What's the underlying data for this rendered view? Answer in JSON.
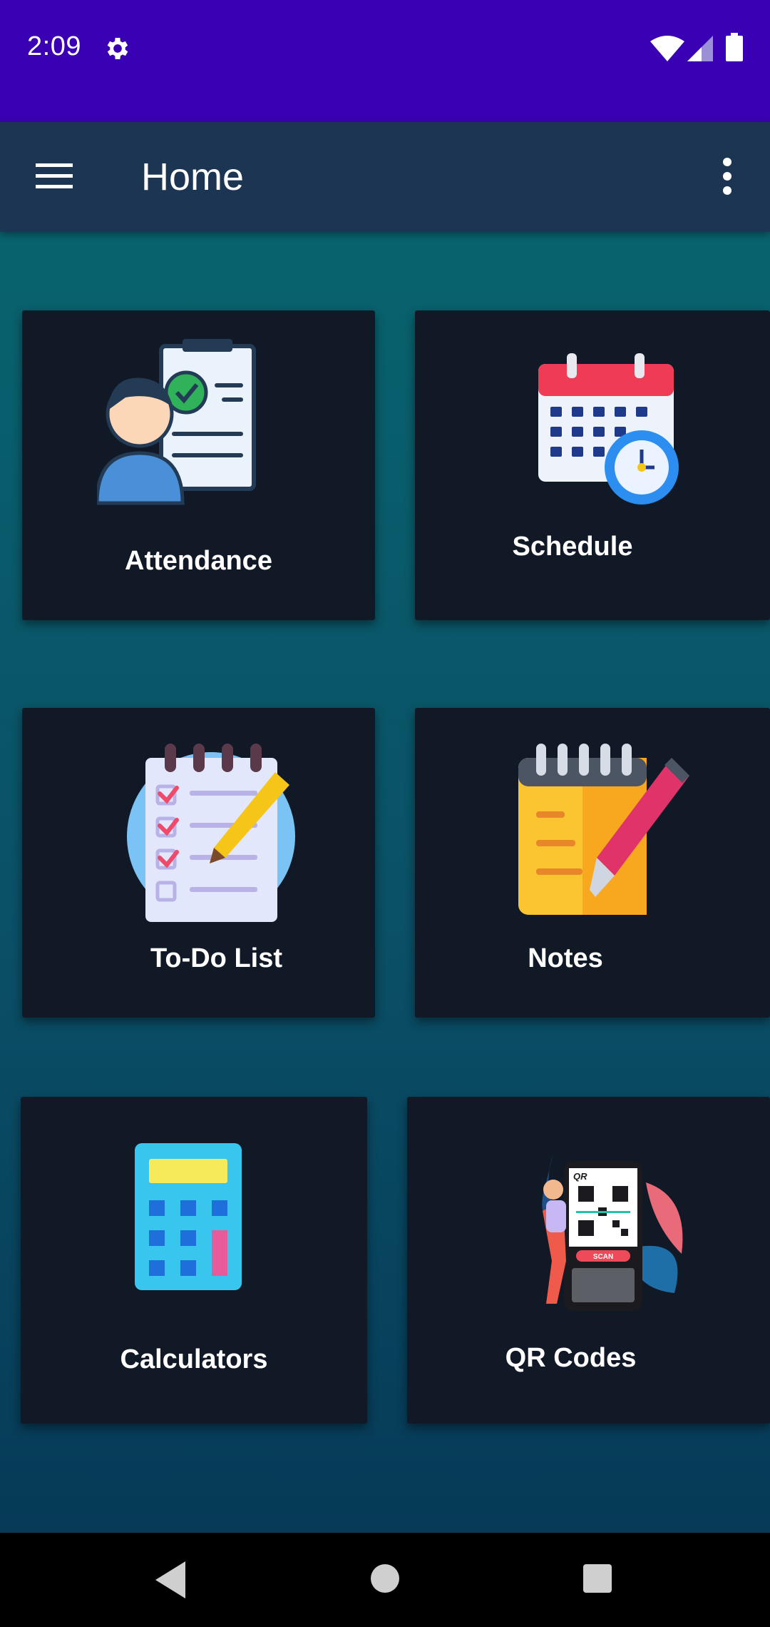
{
  "status_bar": {
    "time": "2:09",
    "icons": [
      "settings-icon",
      "wifi-icon",
      "signal-icon",
      "battery-icon"
    ],
    "background": "#3a00b3"
  },
  "app_bar": {
    "title": "Home",
    "menu_icon": "hamburger-menu-icon",
    "overflow_icon": "more-vert-icon",
    "background": "#1b3552"
  },
  "tiles": [
    {
      "label": "Attendance",
      "icon": "attendance-icon"
    },
    {
      "label": "Schedule",
      "icon": "calendar-clock-icon"
    },
    {
      "label": "To-Do List",
      "icon": "checklist-icon"
    },
    {
      "label": "Notes",
      "icon": "notepad-pen-icon"
    },
    {
      "label": "Calculators",
      "icon": "calculator-icon"
    },
    {
      "label": "QR Codes",
      "icon": "qr-scan-icon",
      "illustration_text": {
        "brand": "QR",
        "button": "SCAN"
      }
    }
  ],
  "nav_bar": {
    "buttons": [
      "back-icon",
      "home-icon",
      "recents-icon"
    ]
  },
  "colors": {
    "tile_background": "#111926",
    "content_gradient_top": "#08636e",
    "content_gradient_bottom": "#063a57"
  }
}
